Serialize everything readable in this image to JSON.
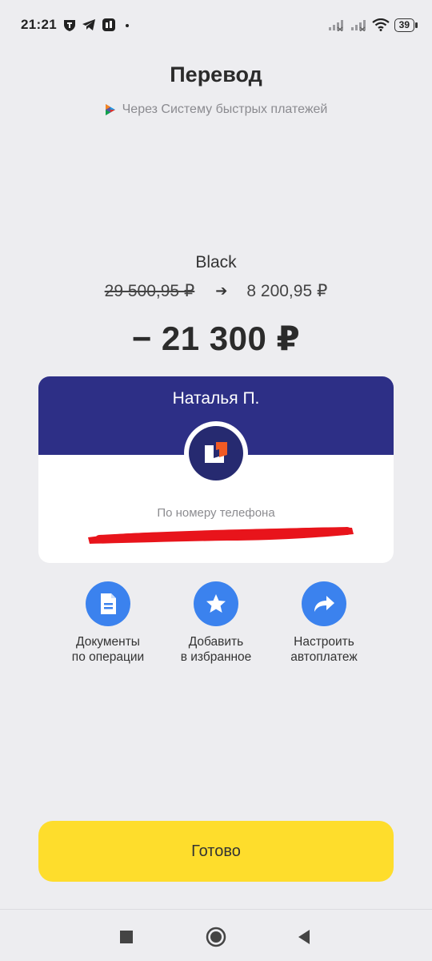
{
  "status_bar": {
    "time": "21:21",
    "battery": "39",
    "left_icons": [
      "shield-notification-icon",
      "telegram-icon",
      "app-notification-icon",
      "more-dot-icon"
    ],
    "right_icons": [
      "signal-1-icon",
      "signal-2-icon",
      "wifi-icon",
      "battery-icon"
    ]
  },
  "header": {
    "title": "Перевод",
    "subtitle": "Через Систему быстрых платежей"
  },
  "transfer": {
    "account_name": "Black",
    "balance_before": "29 500,95 ₽",
    "balance_after": "8 200,95 ₽",
    "amount": "− 21 300 ₽"
  },
  "recipient": {
    "name": "Наталья П.",
    "method": "По номеру телефона"
  },
  "actions": [
    {
      "line1": "Документы",
      "line2": "по операции",
      "icon": "document-icon"
    },
    {
      "line1": "Добавить",
      "line2": "в избранное",
      "icon": "star-icon"
    },
    {
      "line1": "Настроить",
      "line2": "автоплатеж",
      "icon": "share-arrow-icon"
    }
  ],
  "done_button": {
    "label": "Готово"
  },
  "colors": {
    "background": "#ededf0",
    "card_header": "#2d2f86",
    "action_blue": "#3b82ee",
    "done_yellow": "#fedd2c",
    "redaction": "#e8141b",
    "logo_orange": "#f15a24"
  }
}
